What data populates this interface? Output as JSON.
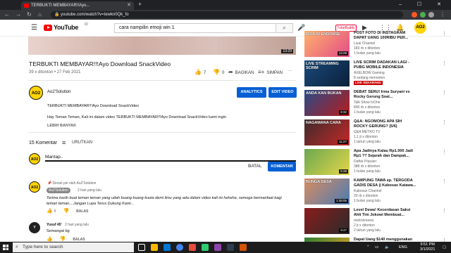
{
  "browser": {
    "tab_title": "TERBUKTI MEMBAYAR!!Ayo...",
    "tab_close": "✕",
    "new_tab": "+",
    "window_controls": "– ☐ ✕",
    "url": "youtube.com/watch?v=tewkn0Qk_fo",
    "nav": {
      "back": "←",
      "forward": "→",
      "reload": "↻",
      "home": "⌂"
    }
  },
  "youtube": {
    "logo_text": "YouTube",
    "country": "ID",
    "search_value": "cara nampilin emoji win 1",
    "tubebuddy": "TubeBuddy",
    "avatar_text": "AO2"
  },
  "video": {
    "title": "TERBUKTI MEMBAYAR!!!Ayo Download SnackVideo",
    "meta": "39 x ditonton  •  27 Feb 2021",
    "likes": "7",
    "dislikes": "0",
    "share": "BAGIKAN",
    "save": "SIMPAN",
    "more": "···",
    "thumb_badge": "13:29"
  },
  "channel": {
    "name": "Ao2'Solution",
    "avatar_text": "AO2",
    "analytics": "ANALYTICS",
    "edit": "EDIT VIDEO"
  },
  "description": {
    "line1": "TERBUKTI MEMBAYAR!!!Ayo Download SnackVideo",
    "line2": "Hay Teman Teman, Kali ini dalam video TERBUKTI MEMBAYAR!!!Ayo Download SnackVideo kami ingin",
    "more": "LEBIH BANYAK"
  },
  "comments": {
    "count": "15 Komentar",
    "sort": "URUTKAN",
    "input_value": "Mantap..",
    "cancel": "BATAL",
    "submit": "KOMENTAR",
    "items": [
      {
        "pinned": "Dinsel pin oleh Ao2'Solution",
        "author": "Ao2'Solution",
        "time": "2 hari yang lalu",
        "text1": "Terima kasih buat teman teman yang udah buang buang kuota demi ilmu yang ada dalam video kali ini hehehe, semoga bermanfaat bagi",
        "text2": "teman teman....Jangan Lupa Terus Dukung Kami...",
        "likes": "5",
        "reply": "BALAS"
      },
      {
        "author": "Yusuf 45'",
        "time": "2 hari yang lalu",
        "text1": "Semangat bg",
        "likes": "",
        "reply": "BALAS"
      }
    ]
  },
  "sidebar": [
    {
      "thumb_text": "BISA DI ENDORSE",
      "duration": "13:29",
      "title1": "POST FOTO DI INSTAGRAM",
      "title2": "DAPAT UANG 100RIBU PER...",
      "channel": "Liyai Channel",
      "stats": "183 rb x ditonton",
      "age": "1 bulan yang lalu",
      "colors": [
        "#ffb36b",
        "#e34b87"
      ]
    },
    {
      "thumb_text": "LIVE STREAMING SCRIM",
      "duration": "",
      "title1": "LIVE SCRIM DADAKAN LAGI -",
      "title2": "PUBG MOBILE INDONESIA",
      "channel": "AXELBOW Gaming",
      "stats": "8 sedang menonton",
      "age": "",
      "live": "LIVE SEKARANG",
      "colors": [
        "#1a4a7a",
        "#0b1f3a"
      ]
    },
    {
      "thumb_text": "ANDA KAN BUKAN",
      "duration": "9:32",
      "title1": "DEBAT SERU! Irma Suryani vs",
      "title2": "Rocky Gerung Soal...",
      "channel": "Talk Show tvOne",
      "stats": "800 rb x ditonton",
      "age": "1 bulan yang lalu",
      "colors": [
        "#274b88",
        "#b71c1c"
      ]
    },
    {
      "thumb_text": "NAGAMANA CARA",
      "duration": "11:27",
      "title1": "Q&A: NGOMONG APA SIH",
      "title2": "ROCKY GERUNG? (5/6)",
      "channel": "Q&A METRO TV",
      "stats": "1,1 jt x ditonton",
      "age": "1 tahun yang lalu",
      "colors": [
        "#3d2b2b",
        "#c62828"
      ]
    },
    {
      "thumb_text": "",
      "duration": "5:28",
      "title1": "Apa Jadinya Kalau Rp1.000 Jadi",
      "title2": "Rp1 ?? Sejarah dan Dampak...",
      "channel": "Daftar Populer",
      "stats": "388 rb x ditonton",
      "age": "1 bulan yang lalu",
      "colors": [
        "#6ba84f",
        "#e5d64a"
      ]
    },
    {
      "thumb_text": "BUNGA DESA",
      "duration": "1:38:05",
      "title1": "KAMPUNG TAWA ep. TERGODA",
      "title2": "GADIS DESA || Kabosax Katawa...",
      "channel": "Kabosax Channel",
      "stats": "20 rb x ditonton",
      "age": "1 bulan yang lalu",
      "colors": [
        "#d98c5f",
        "#4a7bb5"
      ]
    },
    {
      "thumb_text": "",
      "duration": "9:47",
      "title1": "Level Dewa! Kecerdasan Saksi",
      "title2": "Ahli Tim Jokowi Membuat...",
      "channel": "metrotvnews",
      "stats": "2 jt x ditonton",
      "age": "2 tahun yang lalu",
      "colors": [
        "#8a1c1c",
        "#2b2b2b"
      ]
    },
    {
      "thumb_text": "",
      "duration": "",
      "title1": "Dapat Uang $140 menggunakan",
      "title2": "",
      "channel": "",
      "stats": "",
      "age": "",
      "colors": [
        "#2e7d32",
        "#f9a825"
      ]
    }
  ],
  "taskbar": {
    "search_placeholder": "Type here to search",
    "lang": "ENG",
    "time": "9:51 PM",
    "date": "3/1/2021"
  }
}
